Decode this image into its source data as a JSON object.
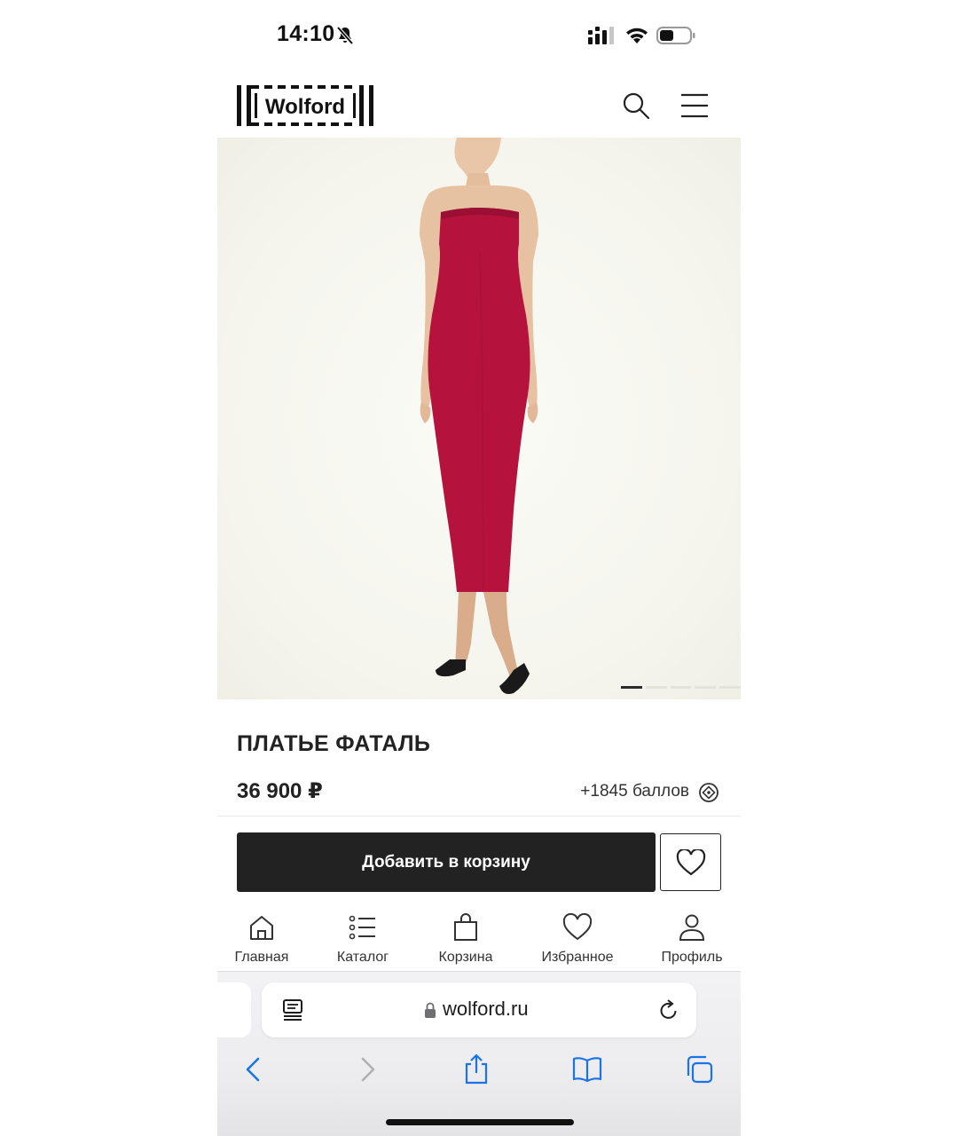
{
  "status_bar": {
    "time": "14:10",
    "icons": [
      "bell-off-icon",
      "signal-icon",
      "wifi-icon",
      "battery-icon"
    ]
  },
  "header": {
    "logo_text": "Wolford",
    "icons": [
      "search-icon",
      "menu-icon"
    ]
  },
  "gallery": {
    "image": "red strapless midi dress on model",
    "slides_total": 5,
    "active_slide": 1
  },
  "product": {
    "title": "ПЛАТЬЕ ФАТАЛЬ",
    "price": "36 900 ₽",
    "bonus": "+1845 баллов",
    "dress_color": "#b5123e"
  },
  "actions": {
    "add_to_cart": "Добавить в корзину",
    "wishlist_icon": "heart-icon"
  },
  "bottom_nav": {
    "items": [
      {
        "label": "Главная",
        "icon": "home-icon"
      },
      {
        "label": "Каталог",
        "icon": "list-icon"
      },
      {
        "label": "Корзина",
        "icon": "bag-icon"
      },
      {
        "label": "Избранное",
        "icon": "heart-icon"
      },
      {
        "label": "Профиль",
        "icon": "user-icon"
      }
    ]
  },
  "browser": {
    "url": "wolford.ru",
    "toolbar": [
      "back-icon",
      "forward-icon",
      "share-icon",
      "bookmarks-icon",
      "tabs-icon"
    ],
    "accent": "#1a73e8"
  }
}
